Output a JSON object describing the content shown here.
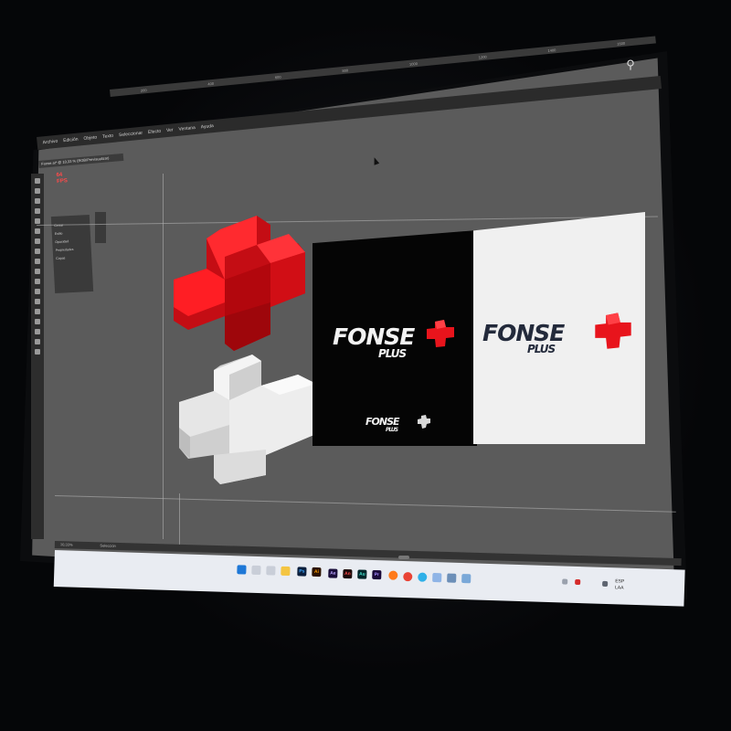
{
  "menu": {
    "items": [
      "Archivo",
      "Edición",
      "Objeto",
      "Texto",
      "Seleccionar",
      "Efecto",
      "Ver",
      "Ventana",
      "Ayuda"
    ]
  },
  "ruler": {
    "ticks": [
      "200",
      "400",
      "600",
      "800",
      "1000",
      "1200",
      "1400",
      "1600"
    ]
  },
  "document": {
    "tab_label": "Fonse.ai* @ 10,33 % (RGB/Previsualizar)"
  },
  "overlay": {
    "fps_value": "64",
    "fps_label": "FPS"
  },
  "properties_panel": {
    "items": [
      "Cerrar",
      "Estilo",
      "Opacidad",
      "Propiedades",
      "Capas"
    ]
  },
  "logos": {
    "brand_main": "FONSE",
    "brand_sub": "PLUS"
  },
  "status_bar": {
    "zoom": "10,33%",
    "tool": "Selección"
  },
  "taskbar": {
    "apps": [
      {
        "name": "photoshop",
        "label": "Ps",
        "color": "#0b1f3d",
        "fg": "#3aa7ff"
      },
      {
        "name": "illustrator",
        "label": "Ai",
        "color": "#2b1200",
        "fg": "#ff9a00"
      },
      {
        "name": "after-effects",
        "label": "Ae",
        "color": "#1a0e3a",
        "fg": "#b9a4ff"
      },
      {
        "name": "animate",
        "label": "An",
        "color": "#1b0a0a",
        "fg": "#ff4d4d"
      },
      {
        "name": "audition",
        "label": "Au",
        "color": "#00262a",
        "fg": "#45e3cf"
      },
      {
        "name": "premiere",
        "label": "Pr",
        "color": "#1a0a3a",
        "fg": "#a38cff"
      }
    ],
    "tray": {
      "language": "ESP",
      "layout": "LAA"
    }
  },
  "colors": {
    "canvas": "#5b5b5b",
    "brand_red": "#e8141c",
    "logo_dark_text": "#232a3b"
  }
}
